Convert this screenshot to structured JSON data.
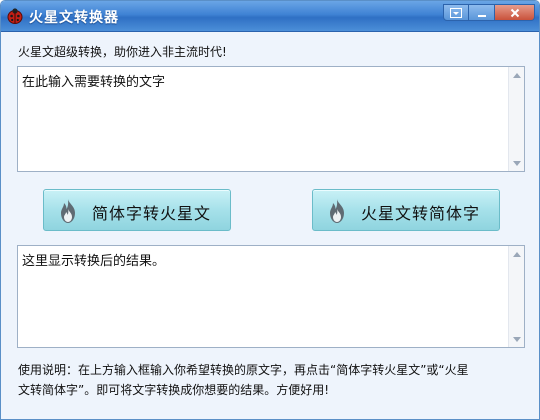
{
  "window": {
    "title": "火星文转换器"
  },
  "tagline": "火星文超级转换，助你进入非主流时代!",
  "input": {
    "text": "在此输入需要转换的文字"
  },
  "output": {
    "text": "这里显示转换后的结果。"
  },
  "buttons": {
    "to_martian": "简体字转火星文",
    "to_simplified": "火星文转简体字"
  },
  "instructions": {
    "line1": "使用说明：在上方输入框输入你希望转换的原文字，再点击“简体字转火星文”或“火星",
    "line2": "文转简体字”。即可将文字转换成你想要的结果。方便好用!"
  },
  "icons": {
    "app": "ladybug-icon",
    "buttons": "flame-icon"
  },
  "colors": {
    "titlebar": "#3f82d4",
    "window_bg": "#eef4fc",
    "button_bg": "#a6e1ea"
  }
}
